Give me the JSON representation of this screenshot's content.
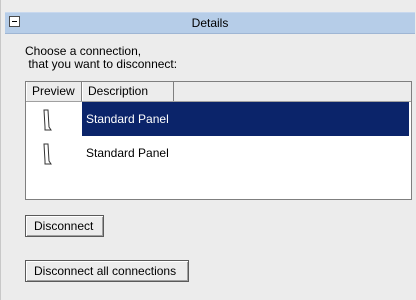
{
  "header": {
    "title": "Details",
    "collapse_icon": "minus-box-icon"
  },
  "instructions": "Choose a connection,\n that you want to disconnect:",
  "list": {
    "columns": [
      "Preview",
      "Description"
    ],
    "rows": [
      {
        "preview_icon": "panel-thumbnail-icon",
        "description": "Standard Panel",
        "selected": true
      },
      {
        "preview_icon": "panel-thumbnail-icon",
        "description": "Standard Panel",
        "selected": false
      }
    ]
  },
  "buttons": {
    "disconnect": "Disconnect",
    "disconnect_all": "Disconnect all connections"
  },
  "colors": {
    "header_bg": "#b6cde8",
    "selection_bg": "#0b246a",
    "panel_bg": "#ececec"
  }
}
